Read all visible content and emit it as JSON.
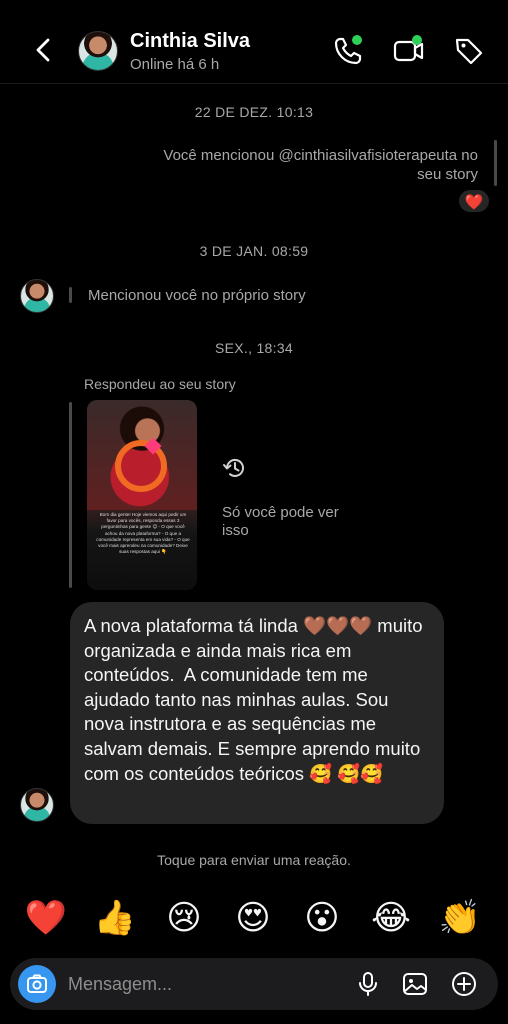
{
  "header": {
    "name": "Cinthia Silva",
    "status": "Online há 6 h"
  },
  "messages": {
    "ts1": "22 DE DEZ. 10:13",
    "mention_text": "Você mencionou @cinthiasilvafisioterapeuta no seu story",
    "heart_reaction": "❤️",
    "ts2": "3 DE JAN. 08:59",
    "story_mention": "Mencionou você no próprio story",
    "ts3": "SEX., 18:34",
    "replied_label": "Respondeu ao seu story",
    "story_card_text": "Bom dia gente! Hoje viemos aqui pedir um favor para vocês, responda essas 3 perguntinhas para gente 😊 - O que você achou da nova plataforma? - O que a comunidade representa em sua vida? - O que você mais aprendeu na comunidade? Deixe suas respostas aqui 👇",
    "hidden_text": "Só você pode ver isso",
    "bubble_text": "A nova plataforma tá linda 🤎🤎🤎 muito organizada e ainda mais rica em conteúdos.  A comunidade tem me ajudado tanto nas minhas aulas. Sou nova instrutora e as sequências me salvam demais. E sempre aprendo muito com os conteúdos teóricos 🥰 🥰🥰"
  },
  "reaction_hint": "Toque para enviar uma reação.",
  "quick_reactions": [
    "❤️",
    "👍",
    "😢",
    "😍",
    "😮",
    "😂",
    "👏"
  ],
  "composer": {
    "placeholder": "Mensagem..."
  },
  "colors": {
    "accent": "#3797f0",
    "online_dot": "#2ed158",
    "bubble": "#262626"
  }
}
